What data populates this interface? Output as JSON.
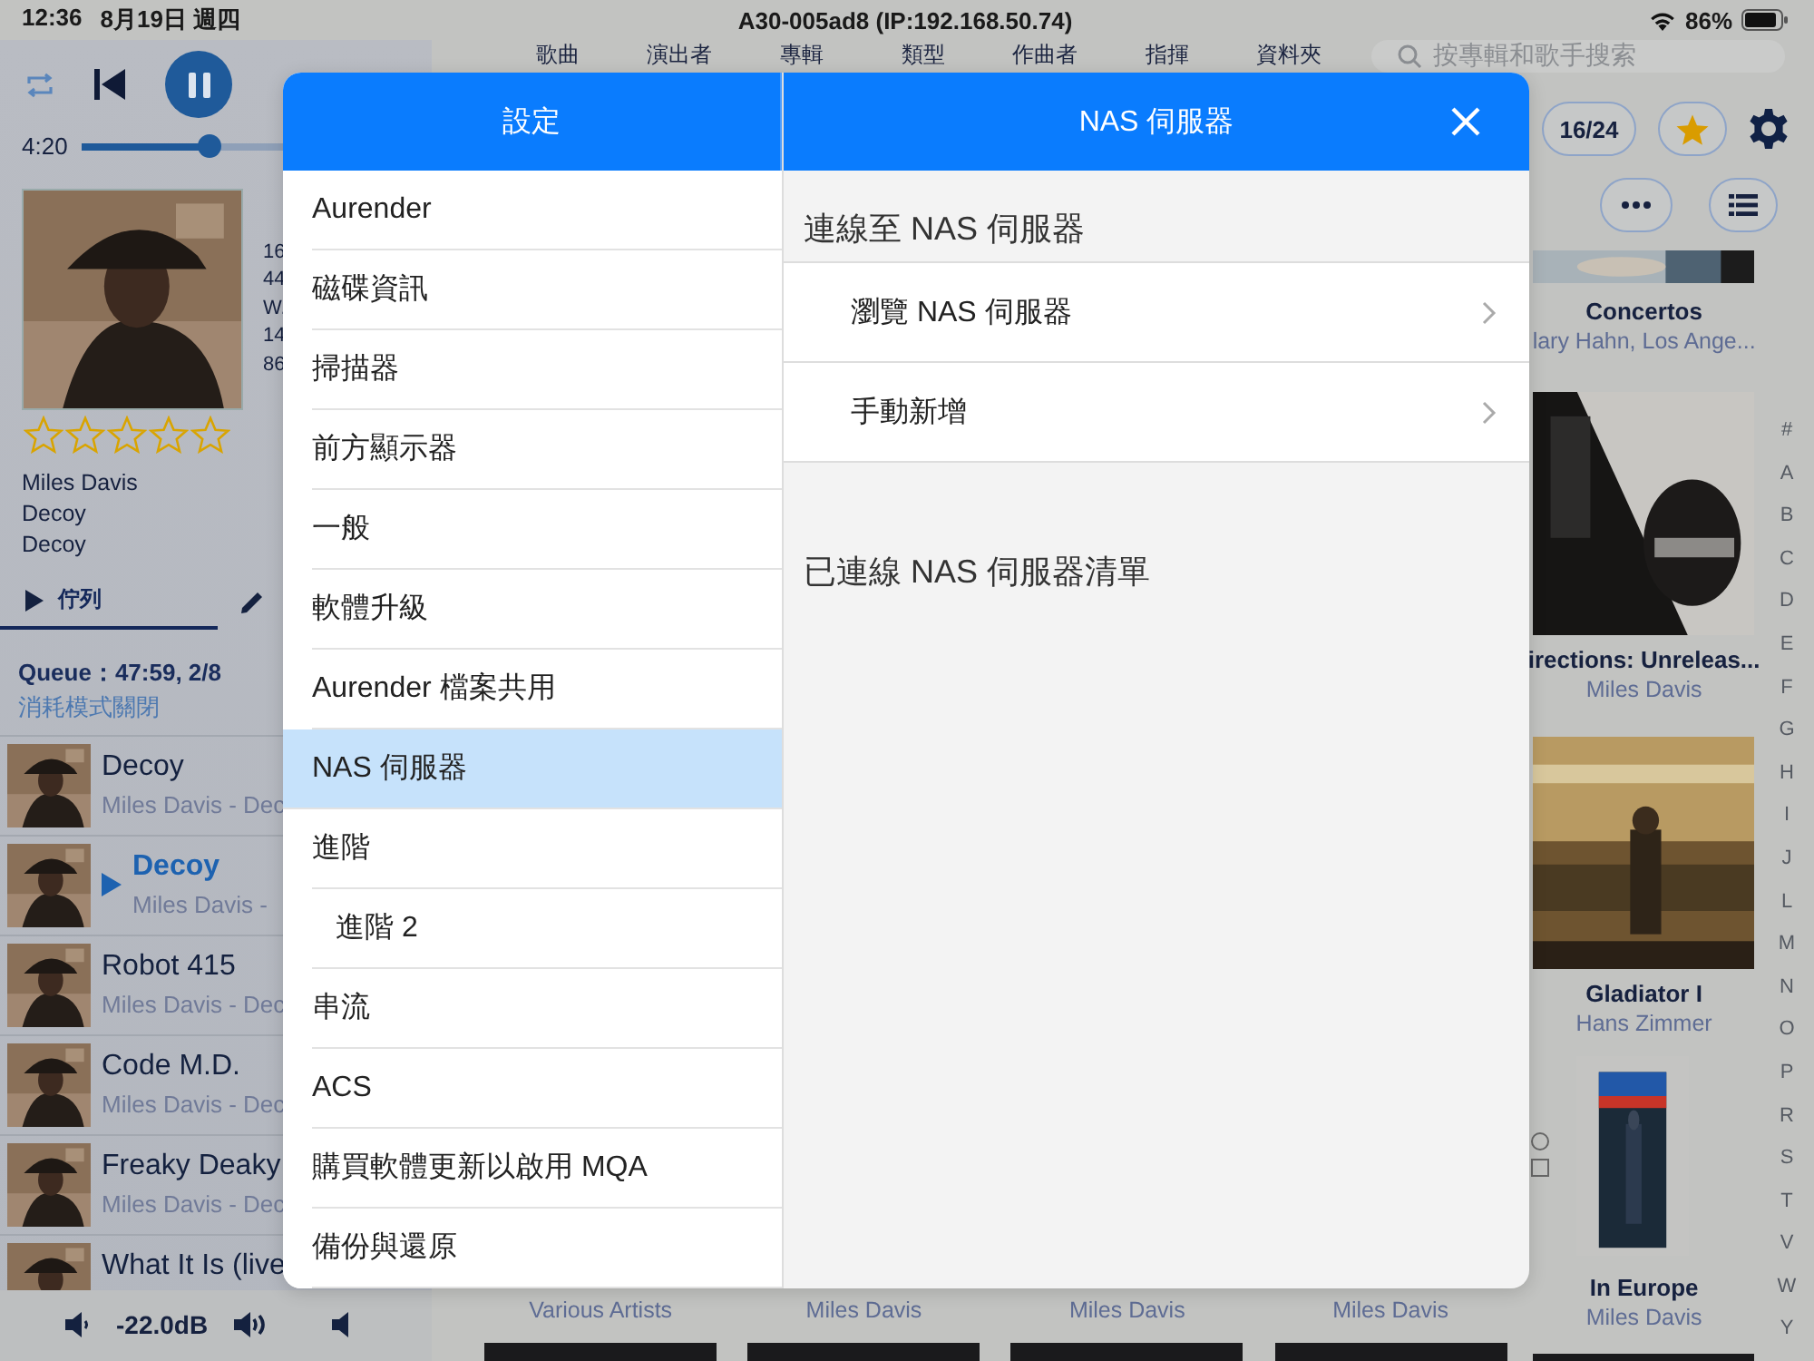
{
  "status_bar": {
    "time": "12:36",
    "date": "8月19日 週四",
    "device": "A30-005ad8 (IP:192.168.50.74)",
    "battery": "86%"
  },
  "player": {
    "elapsed": "4:20",
    "progress": {
      "level": 0.36
    }
  },
  "now_playing": {
    "details": [
      "16",
      "44",
      "W.",
      "14",
      "86"
    ],
    "stars": 0,
    "artist": "Miles Davis",
    "title": "Decoy",
    "album": "Decoy"
  },
  "panel_tabs": [
    {
      "label": "佇列",
      "selected": true
    }
  ],
  "queue": {
    "summary": "Queue：47:59, 2/8",
    "mode": "消耗模式關閉",
    "tracks": [
      {
        "title": "Decoy",
        "subtitle": "Miles Davis - Dec",
        "playing": false
      },
      {
        "title": "Decoy",
        "subtitle": "Miles Davis -",
        "playing": true
      },
      {
        "title": "Robot 415",
        "subtitle": "Miles Davis - Dec",
        "playing": false
      },
      {
        "title": "Code M.D.",
        "subtitle": "Miles Davis - Dec",
        "playing": false
      },
      {
        "title": "Freaky Deaky",
        "subtitle": "Miles Davis - Dec",
        "playing": false
      },
      {
        "title": "What It Is (live",
        "playing": false
      }
    ]
  },
  "volume": {
    "reading": "-22.0dB"
  },
  "library": {
    "nav_tabs": [
      "歌曲",
      "演出者",
      "專輯",
      "類型",
      "作曲者",
      "指揮",
      "資料夾"
    ],
    "search": {
      "placeholder": "按專輯和歌手搜索"
    },
    "page": "16/24",
    "albums": [
      {
        "title": "Concertos",
        "artist": "lary Hahn, Los Ange..."
      },
      {
        "title": "irections: Unreleas...",
        "artist": "Miles Davis"
      },
      {
        "title": "Gladiator I",
        "artist": "Hans Zimmer"
      },
      {
        "title": "In Europe",
        "artist": "Miles Davis"
      }
    ],
    "bottom_artists": [
      "Various Artists",
      "Miles Davis",
      "Miles Davis",
      "Miles Davis"
    ],
    "index": [
      "#",
      "A",
      "B",
      "C",
      "D",
      "E",
      "F",
      "G",
      "H",
      "I",
      "J",
      "L",
      "M",
      "N",
      "O",
      "P",
      "R",
      "S",
      "T",
      "V",
      "W",
      "Y"
    ]
  },
  "settings": {
    "title": "設定",
    "items": [
      {
        "label": "Aurender",
        "selected": false
      },
      {
        "label": "磁碟資訊",
        "selected": false
      },
      {
        "label": "掃描器",
        "selected": false
      },
      {
        "label": "前方顯示器",
        "selected": false
      },
      {
        "label": "一般",
        "selected": false
      },
      {
        "label": "軟體升級",
        "selected": false
      },
      {
        "label": "Aurender 檔案共用",
        "selected": false
      },
      {
        "label": "NAS 伺服器",
        "selected": true
      },
      {
        "label": "進階",
        "selected": false,
        "children": [
          {
            "label": "進階 2",
            "selected": false
          }
        ]
      },
      {
        "label": "串流",
        "selected": false
      },
      {
        "label": "ACS",
        "selected": false
      },
      {
        "label": "購買軟體更新以啟用 MQA",
        "selected": false
      },
      {
        "label": "備份與還原",
        "selected": false
      }
    ]
  },
  "detail": {
    "title": "NAS 伺服器",
    "sections": [
      {
        "heading": "連線至 NAS 伺服器",
        "rows": [
          "瀏覽 NAS 伺服器",
          "手動新增"
        ]
      },
      {
        "heading": "已連線 NAS 伺服器清單"
      }
    ]
  }
}
